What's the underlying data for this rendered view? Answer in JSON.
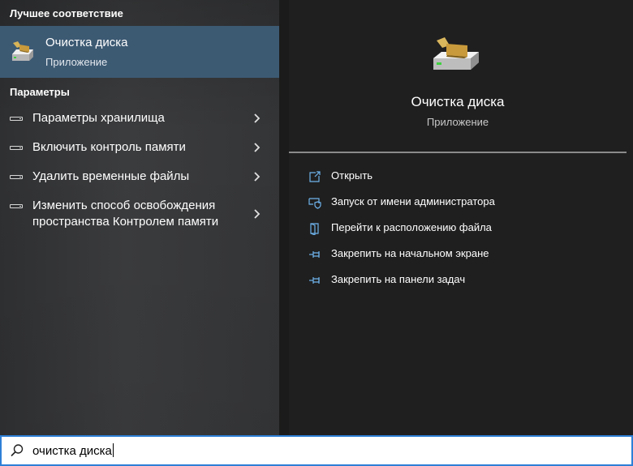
{
  "left_panel": {
    "best_match_title": "Лучшее соответствие",
    "best_match": {
      "name": "Очистка диска",
      "type": "Приложение",
      "icon": "disk-cleanup-icon"
    },
    "settings_title": "Параметры",
    "settings_items": [
      {
        "label": "Параметры хранилища",
        "icon": "storage-icon"
      },
      {
        "label": "Включить контроль памяти",
        "icon": "storage-icon"
      },
      {
        "label": "Удалить временные файлы",
        "icon": "storage-icon"
      },
      {
        "label_line1": "Изменить способ освобождения",
        "label_line2": "пространства Контролем памяти",
        "icon": "storage-icon"
      }
    ]
  },
  "detail_panel": {
    "name": "Очистка диска",
    "type": "Приложение",
    "actions": [
      {
        "label": "Открыть",
        "icon": "open-icon"
      },
      {
        "label": "Запуск от имени администратора",
        "icon": "admin-shield-icon"
      },
      {
        "label": "Перейти к расположению файла",
        "icon": "file-location-icon"
      },
      {
        "label": "Закрепить на начальном экране",
        "icon": "pin-icon"
      },
      {
        "label": "Закрепить на панели задач",
        "icon": "pin-icon"
      }
    ]
  },
  "search": {
    "value": "очистка диска",
    "icon": "search-icon"
  },
  "colors": {
    "accent": "#2d7fd6",
    "selected_item": "#3d5a73",
    "action_icon": "#6fb3ec"
  }
}
